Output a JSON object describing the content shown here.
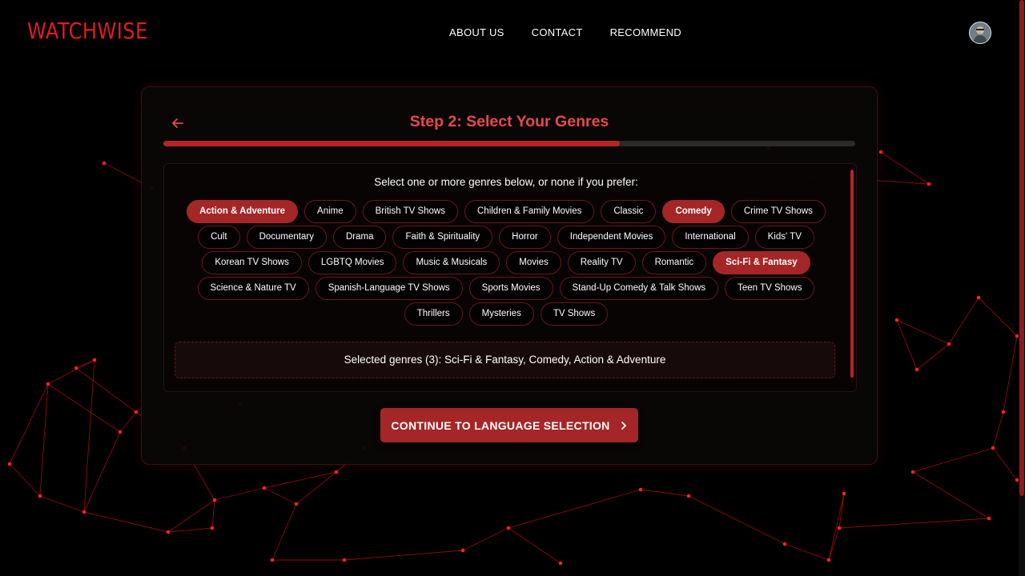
{
  "brand": "WATCHWISE",
  "nav": [
    {
      "label": "ABOUT US"
    },
    {
      "label": "CONTACT"
    },
    {
      "label": "RECOMMEND"
    }
  ],
  "step": {
    "title": "Step 2: Select Your Genres",
    "progress": 0.66
  },
  "prompt": "Select one or more genres below, or none if you prefer:",
  "genres": [
    {
      "label": "Action & Adventure",
      "selected": true
    },
    {
      "label": "Anime",
      "selected": false
    },
    {
      "label": "British TV Shows",
      "selected": false
    },
    {
      "label": "Children & Family Movies",
      "selected": false
    },
    {
      "label": "Classic",
      "selected": false
    },
    {
      "label": "Comedy",
      "selected": true
    },
    {
      "label": "Crime TV Shows",
      "selected": false
    },
    {
      "label": "Cult",
      "selected": false
    },
    {
      "label": "Documentary",
      "selected": false
    },
    {
      "label": "Drama",
      "selected": false
    },
    {
      "label": "Faith & Spirituality",
      "selected": false
    },
    {
      "label": "Horror",
      "selected": false
    },
    {
      "label": "Independent Movies",
      "selected": false
    },
    {
      "label": "International",
      "selected": false
    },
    {
      "label": "Kids' TV",
      "selected": false
    },
    {
      "label": "Korean TV Shows",
      "selected": false
    },
    {
      "label": "LGBTQ Movies",
      "selected": false
    },
    {
      "label": "Music & Musicals",
      "selected": false
    },
    {
      "label": "Movies",
      "selected": false
    },
    {
      "label": "Reality TV",
      "selected": false
    },
    {
      "label": "Romantic",
      "selected": false
    },
    {
      "label": "Sci-Fi & Fantasy",
      "selected": true
    },
    {
      "label": "Science & Nature TV",
      "selected": false
    },
    {
      "label": "Spanish-Language TV Shows",
      "selected": false
    },
    {
      "label": "Sports Movies",
      "selected": false
    },
    {
      "label": "Stand-Up Comedy & Talk Shows",
      "selected": false
    },
    {
      "label": "Teen TV Shows",
      "selected": false
    },
    {
      "label": "Thrillers",
      "selected": false
    },
    {
      "label": "Mysteries",
      "selected": false
    },
    {
      "label": "TV Shows",
      "selected": false
    }
  ],
  "summary": "Selected genres (3): Sci-Fi & Fantasy, Comedy, Action & Adventure",
  "continue_label": "CONTINUE TO LANGUAGE SELECTION",
  "colors": {
    "accent": "#a52626",
    "brand": "#e01d1d",
    "title": "#e84a4a",
    "background": "#000000"
  },
  "icons": {
    "back": "arrow-left-icon",
    "continue": "chevron-right-icon",
    "avatar": "avatar"
  }
}
